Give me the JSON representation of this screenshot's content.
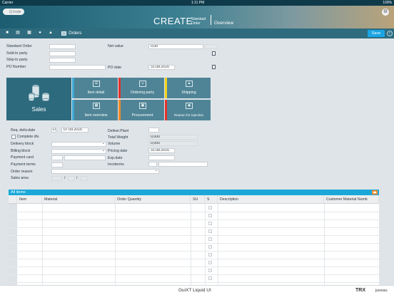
{
  "status": {
    "carrier": "Carrier",
    "time": "1:11 PM",
    "battery": "100%"
  },
  "header": {
    "search_placeholder": "Q trxde",
    "title": "CREATE",
    "subtitle_line1": "Standard",
    "subtitle_line2": "Order",
    "section": "Overview"
  },
  "toolbar": {
    "orders_label": "Orders",
    "save_label": "Save"
  },
  "form": {
    "standard_order_label": "Standard Order",
    "sold_to_label": "Sold-to party",
    "ship_to_label": "Ship-to party",
    "po_number_label": "PO Number",
    "net_value_label": "Net value",
    "net_value": "0,00",
    "po_date_label": "PO date",
    "po_date": "31.08.2016"
  },
  "sales_label": "Sales",
  "tiles": {
    "item_detail": "Item detail",
    "ordering_party": "Ordering party",
    "shipping": "Shipping",
    "item_overview": "Item overview",
    "procurement": "Procurement",
    "reason_for_rejection": "Reason for rejection"
  },
  "details": {
    "req_deliv_date_label": "Req. deliv.date",
    "req_deliv_prefix": "D",
    "req_deliv_date": "07.09.2016",
    "complete_dlv_label": "Complete dlv.",
    "delivery_block_label": "Delivery block",
    "billing_block_label": "Billing block",
    "payment_card_label": "Payment card",
    "payment_terms_label": "Payment terms",
    "order_reason_label": "Order reason",
    "sales_area_label": "Sales area",
    "sep": "/",
    "deliver_plant_label": "Deliver.Plant",
    "total_weight_label": "Total Weight",
    "total_weight": "0,000",
    "volume_label": "Volume",
    "volume": "0,000",
    "pricing_date_label": "Pricing date",
    "pricing_date": "31.08.2016",
    "exp_date_label": "Exp.date",
    "incoterms_label": "Incoterms"
  },
  "items": {
    "title": "All items",
    "columns": [
      "Item",
      "Material",
      "Order Quantity",
      "SU",
      "S",
      "Description",
      "Customer Material Numb"
    ]
  },
  "footer": {
    "center": "GuiXT Liquid UI",
    "brand": "TRX",
    "user": "juneau"
  },
  "colors": {
    "toolbar": "#2e6b7e",
    "save": "#1aa5e5",
    "list_header": "#1ba8d9",
    "accent_orange": "#f28a2a"
  }
}
